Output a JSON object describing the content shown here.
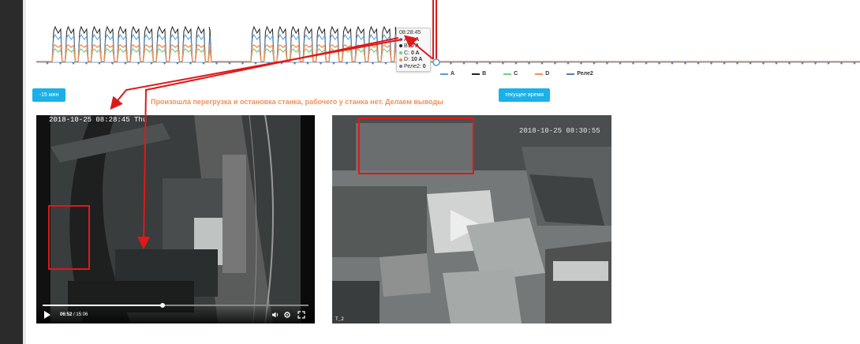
{
  "chart_data": {
    "type": "line",
    "tooltip": {
      "time": "08:28:45",
      "rows": [
        {
          "label": "A: ",
          "value": "0 A",
          "color": "#5b9bd5"
        },
        {
          "label": "B: ",
          "value": "0 A",
          "color": "#222222"
        },
        {
          "label": "C: ",
          "value": "0 A",
          "color": "#6fd08a"
        },
        {
          "label": "D: ",
          "value": "10 A",
          "color": "#f0905a"
        },
        {
          "label": "Реле2: ",
          "value": "0",
          "color": "#5b7fa8"
        }
      ]
    },
    "legend": [
      {
        "name": "A",
        "color": "#5b9bd5"
      },
      {
        "name": "B",
        "color": "#222222"
      },
      {
        "name": "C",
        "color": "#6fd08a"
      },
      {
        "name": "D",
        "color": "#f0905a"
      },
      {
        "name": "Реле2",
        "color": "#5b7fa8"
      }
    ],
    "colors": {
      "A": "#5b9bd5",
      "B": "#222222",
      "C": "#6fd08a",
      "D": "#f0905a",
      "relay": "#5b7fa8"
    }
  },
  "toolbar": {
    "back_label": "-15 мин",
    "now_label": "текущее время"
  },
  "note": "Произошла перегрузка и остановка станка, рабочего у станка нет. Делаем выводы",
  "video_left": {
    "timestamp": "2018-10-25 08:28:45 Thu",
    "current_time": "06:52",
    "separator": " / ",
    "duration": "15:06",
    "progress": 0.45
  },
  "video_right": {
    "timestamp": "2018-10-25 08:30:55",
    "camera_label": "T_2"
  },
  "icons": {
    "play": "play-icon",
    "volume": "volume-icon",
    "settings": "gear-icon",
    "fullscreen": "fullscreen-icon"
  }
}
